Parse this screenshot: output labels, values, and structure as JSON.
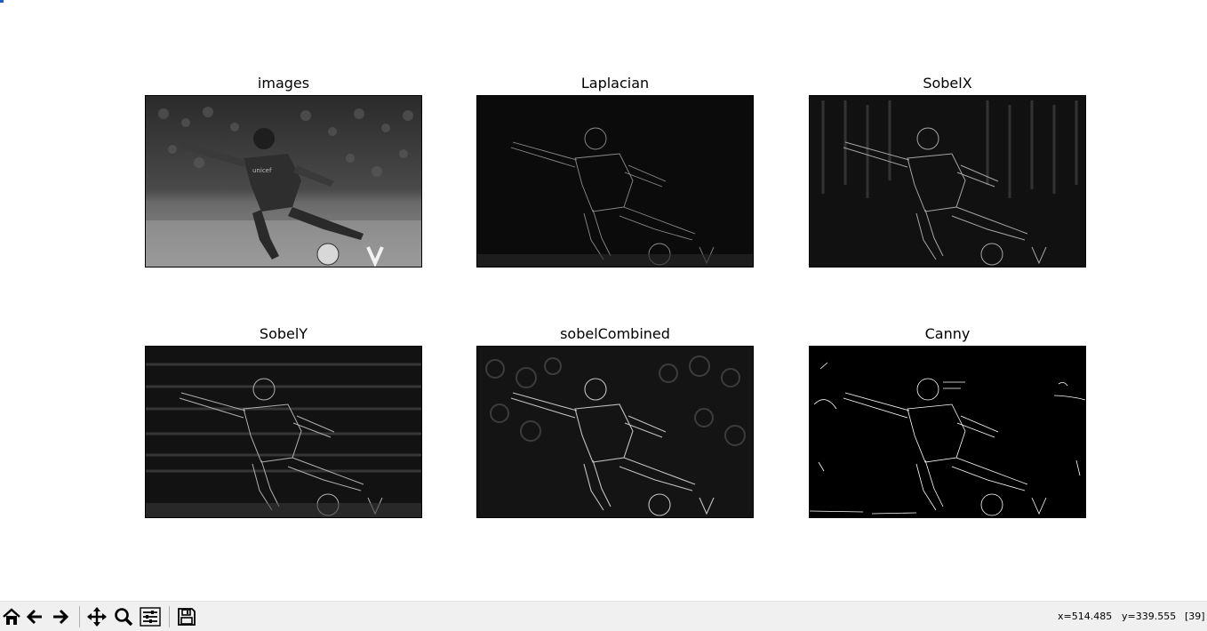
{
  "panels": [
    {
      "title": "images"
    },
    {
      "title": "Laplacian"
    },
    {
      "title": "SobelX"
    },
    {
      "title": "SobelY"
    },
    {
      "title": "sobelCombined"
    },
    {
      "title": "Canny"
    }
  ],
  "toolbar": {
    "buttons": [
      {
        "icon": "home-icon"
      },
      {
        "icon": "back-arrow-icon"
      },
      {
        "icon": "forward-arrow-icon"
      },
      {
        "icon": "pan-icon"
      },
      {
        "icon": "zoom-icon"
      },
      {
        "icon": "sliders-icon"
      },
      {
        "icon": "save-icon"
      }
    ]
  },
  "status": {
    "x": "x=514.485",
    "y": "y=339.555",
    "value": "[39]"
  }
}
